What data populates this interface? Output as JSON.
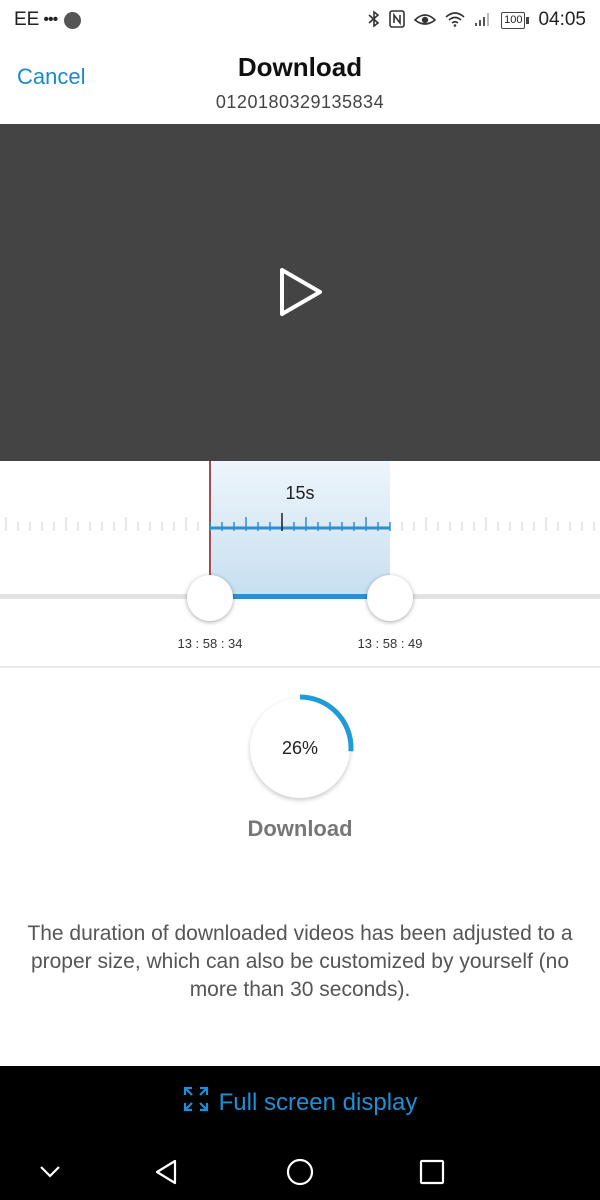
{
  "status_bar": {
    "carrier": "EE",
    "carrier_dots": "•••",
    "battery": "100",
    "time": "04:05",
    "icons": [
      "bluetooth-icon",
      "nfc-icon",
      "eye-icon",
      "wifi-icon",
      "signal-icon",
      "battery-icon"
    ]
  },
  "header": {
    "cancel_label": "Cancel",
    "title": "Download",
    "subtitle": "0120180329135834"
  },
  "video": {
    "background": "#444444",
    "play_icon": "play-icon"
  },
  "timeline": {
    "duration_label": "15s",
    "start_time": "13 : 58 : 34",
    "end_time": "13 : 58 : 49",
    "accent": "#2e8fd0"
  },
  "progress": {
    "percent_label": "26%",
    "percent_value": 26,
    "accent": "#1f9bd7"
  },
  "download_label": "Download",
  "info_text": "The duration of downloaded videos has been adjusted to a proper size, which can also be customized by yourself (no more than 30 seconds).",
  "bottom": {
    "fullscreen_label": "Full screen display",
    "fullscreen_icon": "expand-icon",
    "nav_icons": [
      "chevron-down-icon",
      "back-icon",
      "home-icon",
      "recents-icon"
    ]
  }
}
